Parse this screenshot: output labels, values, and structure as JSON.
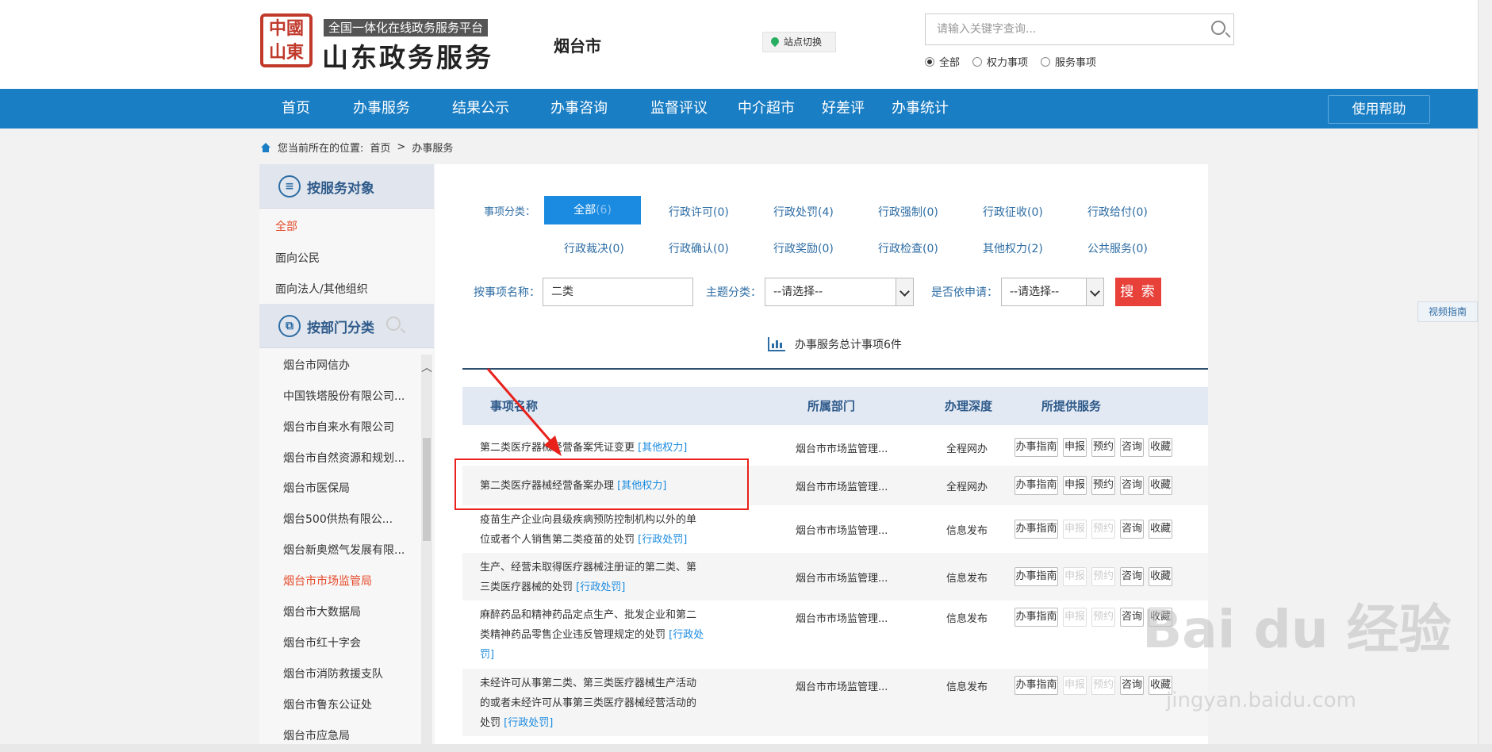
{
  "header": {
    "logo_badge": "全国一体化在线政务服务平台",
    "logo_title": "山东政务服务",
    "logo_seal": [
      "中",
      "國",
      "山",
      "東"
    ],
    "city": "烟台市",
    "site_switch": "站点切换",
    "search_placeholder": "请输入关键字查询...",
    "search_scopes": [
      {
        "label": "全部",
        "selected": true
      },
      {
        "label": "权力事项",
        "selected": false
      },
      {
        "label": "服务事项",
        "selected": false
      }
    ]
  },
  "nav": {
    "items": [
      "首页",
      "办事服务",
      "结果公示",
      "办事咨询",
      "监督评议",
      "中介超市",
      "好差评",
      "办事统计"
    ],
    "help": "使用帮助"
  },
  "breadcrumb": {
    "prefix": "您当前所在的位置:",
    "home": "首页",
    "sep": ">",
    "current": "办事服务"
  },
  "sidebar": {
    "by_target_title": "按服务对象",
    "targets": [
      "全部",
      "面向公民",
      "面向法人/其他组织"
    ],
    "by_dept_title": "按部门分类",
    "departments": [
      "烟台市网信办",
      "中国铁塔股份有限公司...",
      "烟台市自来水有限公司",
      "烟台市自然资源和规划...",
      "烟台市医保局",
      "烟台500供热有限公...",
      "烟台新奥燃气发展有限...",
      "烟台市市场监管局",
      "烟台市大数据局",
      "烟台市红十字会",
      "烟台市消防救援支队",
      "烟台市鲁东公证处",
      "烟台市应急局"
    ],
    "active_department": "烟台市市场监管局"
  },
  "filters": {
    "category_label": "事项分类：",
    "all_label": "全部",
    "all_count": "(6)",
    "categories": [
      "行政许可(0)",
      "行政处罚(4)",
      "行政强制(0)",
      "行政征收(0)",
      "行政给付(0)",
      "行政裁决(0)",
      "行政确认(0)",
      "行政奖励(0)",
      "行政检查(0)",
      "其他权力(2)",
      "公共服务(0)"
    ],
    "name_label": "按事项名称：",
    "name_value": "二类",
    "theme_label": "主题分类：",
    "theme_value": "--请选择--",
    "apply_label": "是否依申请：",
    "apply_value": "--请选择--",
    "search_button": "搜 索",
    "total": "办事服务总计事项6件"
  },
  "table": {
    "headers": [
      "事项名称",
      "所属部门",
      "办理深度",
      "所提供服务"
    ],
    "buttons": [
      "办事指南",
      "申报",
      "预约",
      "咨询",
      "收藏"
    ],
    "rows": [
      {
        "lines": [
          "第二类医疗器械经营备案凭证变更"
        ],
        "tag": "[其他权力]",
        "dept": "烟台市市场监管理...",
        "depth": "全程网办",
        "enabled": [
          true,
          true,
          true,
          true,
          true
        ]
      },
      {
        "lines": [
          "第二类医疗器械经营备案办理"
        ],
        "tag": "[其他权力]",
        "dept": "烟台市市场监管理...",
        "depth": "全程网办",
        "enabled": [
          true,
          true,
          true,
          true,
          true
        ]
      },
      {
        "lines": [
          "疫苗生产企业向县级疾病预防控制机构以外的单",
          "位或者个人销售第二类疫苗的处罚"
        ],
        "tag": "[行政处罚]",
        "dept": "烟台市市场监管理...",
        "depth": "信息发布",
        "enabled": [
          true,
          false,
          false,
          true,
          true
        ]
      },
      {
        "lines": [
          "生产、经营未取得医疗器械注册证的第二类、第",
          "三类医疗器械的处罚"
        ],
        "tag": "[行政处罚]",
        "dept": "烟台市市场监管理...",
        "depth": "信息发布",
        "enabled": [
          true,
          false,
          false,
          true,
          true
        ]
      },
      {
        "lines": [
          "麻醉药品和精神药品定点生产、批发企业和第二",
          "类精神药品零售企业违反管理规定的处罚"
        ],
        "tag": "[行政处罚]",
        "dept": "烟台市市场监管理...",
        "depth": "信息发布",
        "enabled": [
          true,
          false,
          false,
          true,
          true
        ]
      },
      {
        "lines": [
          "未经许可从事第二类、第三类医疗器械生产活动",
          "的或者未经许可从事第三类医疗器械经营活动的",
          "处罚"
        ],
        "tag": "[行政处罚]",
        "dept": "烟台市市场监管理...",
        "depth": "信息发布",
        "enabled": [
          true,
          false,
          false,
          true,
          true
        ]
      }
    ]
  },
  "side_tab": "视频指南",
  "watermark": {
    "logo": "Bai du 经验",
    "url": "jingyan.baidu.com"
  },
  "colors": {
    "primary": "#1a7ec4",
    "danger": "#e8413a",
    "highlight": "#e8211b",
    "active": "#e64b2b"
  }
}
